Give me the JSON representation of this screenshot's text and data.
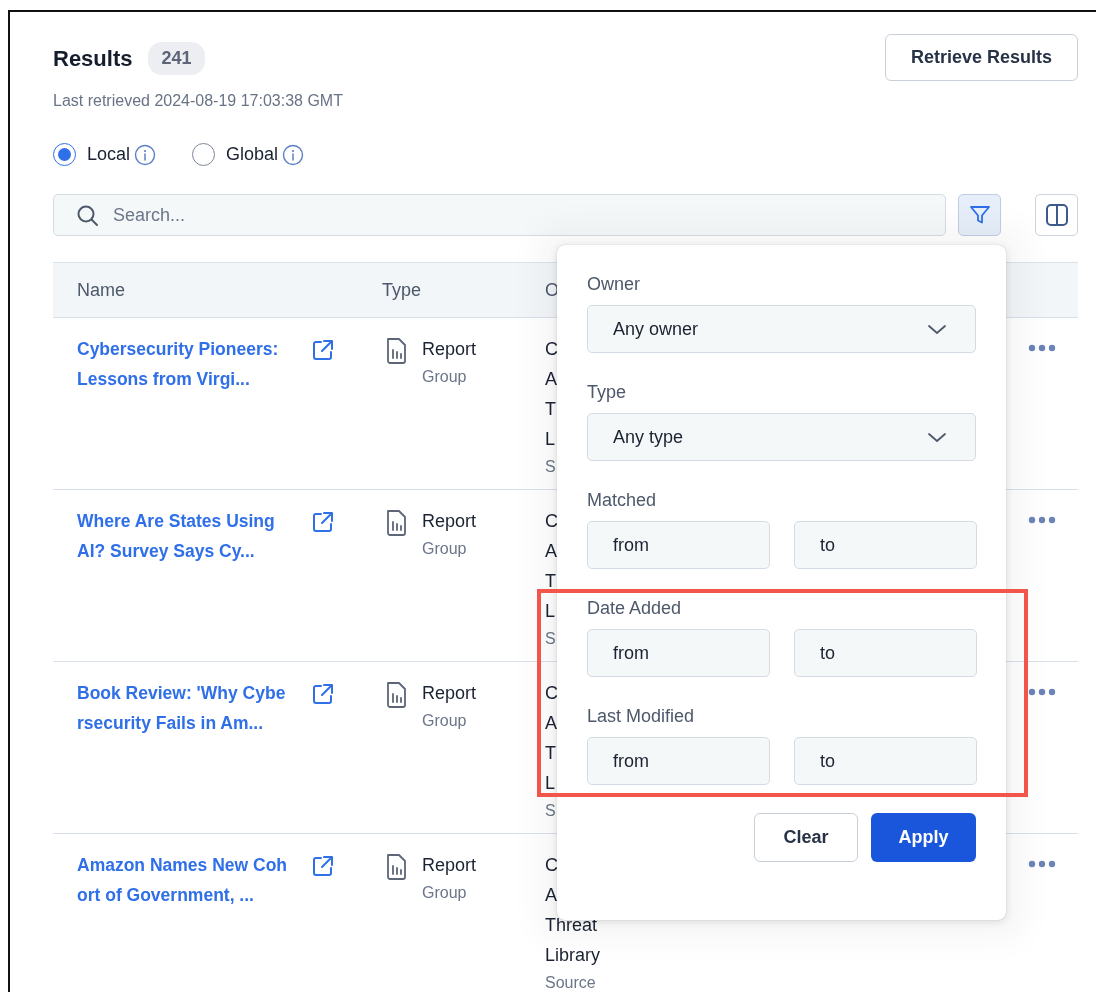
{
  "header": {
    "title": "Results",
    "count": "241",
    "subtitle": "Last retrieved 2024-08-19 17:03:38 GMT",
    "retrieve_button": "Retrieve Results"
  },
  "scope_options": [
    {
      "label": "Local",
      "selected": true
    },
    {
      "label": "Global",
      "selected": false
    }
  ],
  "search": {
    "placeholder": "Search..."
  },
  "filter_button": {
    "active": true
  },
  "table": {
    "columns": [
      "Name",
      "Type",
      "O"
    ],
    "rows": [
      {
        "name": "Cybersecurity Pioneers: Lessons from Virgi...",
        "type": "Report",
        "type_sub": "Group",
        "column_3": [
          "C",
          "A",
          "T",
          "L"
        ],
        "column_3_sub": "S"
      },
      {
        "name": "Where Are States Using AI? Survey Says Cy...",
        "type": "Report",
        "type_sub": "Group",
        "column_3": [
          "C",
          "A",
          "T",
          "L"
        ],
        "column_3_sub": "S"
      },
      {
        "name": "Book Review: 'Why Cybersecurity Fails in Am...",
        "type": "Report",
        "type_sub": "Group",
        "column_3": [
          "C",
          "A",
          "T",
          "L"
        ],
        "column_3_sub": "S"
      },
      {
        "name": "Amazon Names New Cohort of Government, ...",
        "type": "Report",
        "type_sub": "Group",
        "column_3": [
          "C",
          "A",
          "Threat",
          "Library"
        ],
        "column_3_sub": "Source"
      }
    ]
  },
  "filter_panel": {
    "fields": [
      {
        "kind": "select",
        "label": "Owner",
        "value": "Any owner"
      },
      {
        "kind": "select",
        "label": "Type",
        "value": "Any type"
      },
      {
        "kind": "range",
        "label": "Matched",
        "from_placeholder": "from",
        "to_placeholder": "to"
      },
      {
        "kind": "range",
        "label": "Date Added",
        "from_placeholder": "from",
        "to_placeholder": "to",
        "highlighted": true
      },
      {
        "kind": "range",
        "label": "Last Modified",
        "from_placeholder": "from",
        "to_placeholder": "to",
        "highlighted": true
      }
    ],
    "clear_button": "Clear",
    "apply_button": "Apply"
  }
}
